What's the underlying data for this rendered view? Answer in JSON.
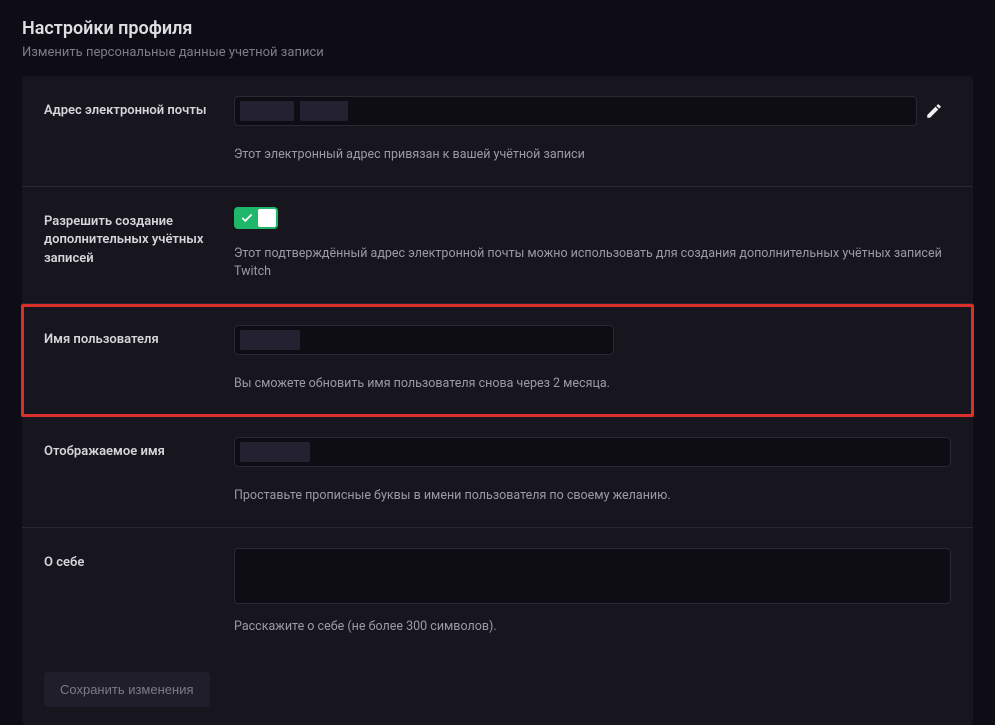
{
  "page": {
    "title": "Настройки профиля",
    "subtitle": "Изменить персональные данные учетной записи"
  },
  "fields": {
    "email": {
      "label": "Адрес электронной почты",
      "value": "",
      "help": "Этот электронный адрес привязан к вашей учётной записи"
    },
    "allow_additional": {
      "label": "Разрешить создание дополнительных учётных записей",
      "enabled": true,
      "help": "Этот подтверждённый адрес электронной почты можно использовать для создания дополнительных учётных записей Twitch"
    },
    "username": {
      "label": "Имя пользователя",
      "value": "",
      "help": "Вы сможете обновить имя пользователя снова через 2 месяца."
    },
    "display_name": {
      "label": "Отображаемое имя",
      "value": "",
      "help": "Проставьте прописные буквы в имени пользователя по своему желанию."
    },
    "bio": {
      "label": "О себе",
      "value": "",
      "help": "Расскажите о себе (не более 300 символов)."
    }
  },
  "buttons": {
    "save": "Сохранить изменения"
  },
  "colors": {
    "highlight": "#d9302c",
    "toggle_on": "#1fb86a"
  }
}
